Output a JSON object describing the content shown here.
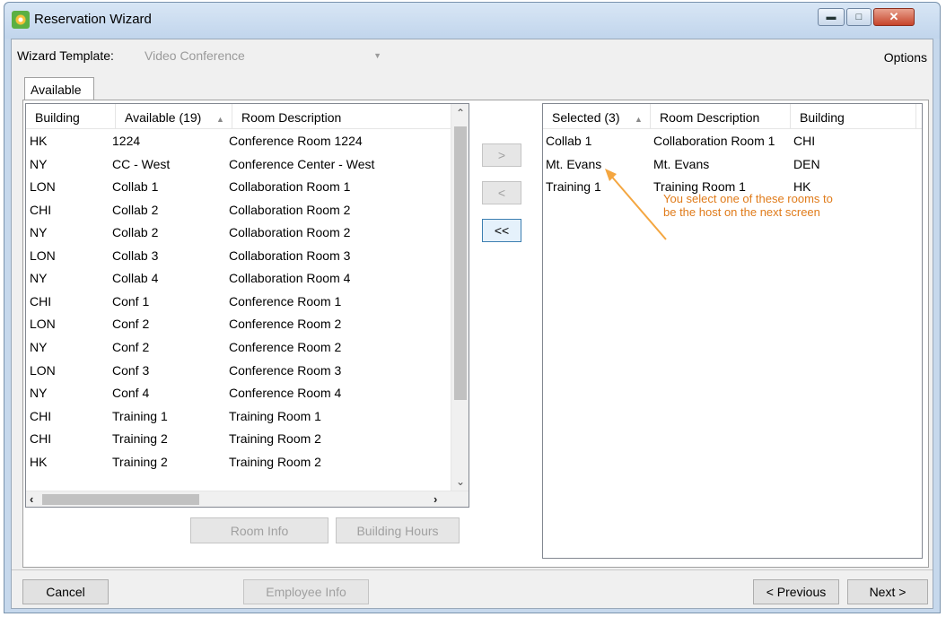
{
  "window": {
    "title": "Reservation Wizard"
  },
  "template": {
    "label": "Wizard Template:",
    "value": "Video Conference",
    "options_label": "Options"
  },
  "tab": {
    "label": "Available"
  },
  "available": {
    "headers": [
      "Building",
      "Available (19)",
      "Room Description"
    ],
    "rows": [
      [
        "HK",
        "1224",
        "Conference Room 1224"
      ],
      [
        "NY",
        "CC - West",
        "Conference Center - West"
      ],
      [
        "LON",
        "Collab 1",
        "Collaboration Room 1"
      ],
      [
        "CHI",
        "Collab 2",
        "Collaboration Room 2"
      ],
      [
        "NY",
        "Collab 2",
        "Collaboration Room 2"
      ],
      [
        "LON",
        "Collab 3",
        "Collaboration Room 3"
      ],
      [
        "NY",
        "Collab 4",
        "Collaboration Room 4"
      ],
      [
        "CHI",
        "Conf 1",
        "Conference Room 1"
      ],
      [
        "LON",
        "Conf 2",
        "Conference Room 2"
      ],
      [
        "NY",
        "Conf 2",
        "Conference Room 2"
      ],
      [
        "LON",
        "Conf 3",
        "Conference Room 3"
      ],
      [
        "NY",
        "Conf 4",
        "Conference Room 4"
      ],
      [
        "CHI",
        "Training 1",
        "Training Room 1"
      ],
      [
        "CHI",
        "Training 2",
        "Training Room 2"
      ],
      [
        "HK",
        "Training 2",
        "Training Room 2"
      ]
    ]
  },
  "selected": {
    "headers": [
      "Selected (3)",
      "Room Description",
      "Building"
    ],
    "rows": [
      [
        "Collab 1",
        "Collaboration Room 1",
        "CHI"
      ],
      [
        "Mt. Evans",
        "Mt. Evans",
        "DEN"
      ],
      [
        "Training 1",
        "Training Room 1",
        "HK"
      ]
    ]
  },
  "transfer": {
    "add": ">",
    "remove": "<",
    "remove_all": "<<"
  },
  "panel_buttons": {
    "room_info": "Room Info",
    "building_hours": "Building Hours"
  },
  "annotation": {
    "text": "You select one of these rooms to be the host on the next screen"
  },
  "footer": {
    "cancel": "Cancel",
    "employee_info": "Employee Info",
    "previous": "< Previous",
    "next": "Next >"
  }
}
